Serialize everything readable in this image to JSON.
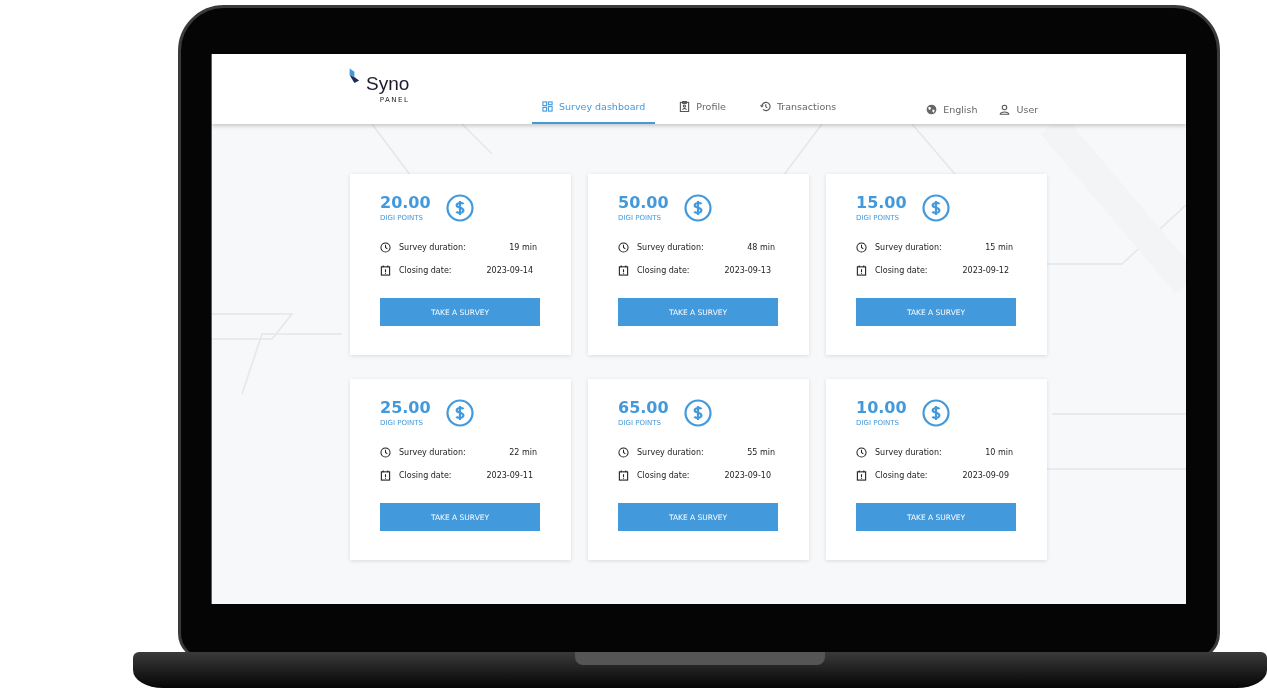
{
  "brand": {
    "name": "Syno",
    "tagline": "PANEL"
  },
  "nav": [
    {
      "label": "Survey dashboard",
      "selected": true
    },
    {
      "label": "Profile",
      "selected": false
    },
    {
      "label": "Transactions",
      "selected": false
    }
  ],
  "actions": [
    {
      "label": "English"
    },
    {
      "label": "User"
    }
  ],
  "surveys": [
    {
      "points": "20.00",
      "unit": "DIGI POINTS",
      "duration_label": "Survey duration:",
      "duration": "19 min",
      "closing_label": "Closing date:",
      "closing_date": "2023-09-14",
      "button": "TAKE A SURVEY"
    },
    {
      "points": "50.00",
      "unit": "DIGI POINTS",
      "duration_label": "Survey duration:",
      "duration": "48 min",
      "closing_label": "Closing date:",
      "closing_date": "2023-09-13",
      "button": "TAKE A SURVEY"
    },
    {
      "points": "15.00",
      "unit": "DIGI POINTS",
      "duration_label": "Survey duration:",
      "duration": "15 min",
      "closing_label": "Closing date:",
      "closing_date": "2023-09-12",
      "button": "TAKE A SURVEY"
    },
    {
      "points": "25.00",
      "unit": "DIGI POINTS",
      "duration_label": "Survey duration:",
      "duration": "22 min",
      "closing_label": "Closing date:",
      "closing_date": "2023-09-11",
      "button": "TAKE A SURVEY"
    },
    {
      "points": "65.00",
      "unit": "DIGI POINTS",
      "duration_label": "Survey duration:",
      "duration": "55 min",
      "closing_label": "Closing date:",
      "closing_date": "2023-09-10",
      "button": "TAKE A SURVEY"
    },
    {
      "points": "10.00",
      "unit": "DIGI POINTS",
      "duration_label": "Survey duration:",
      "duration": "10 min",
      "closing_label": "Closing date:",
      "closing_date": "2023-09-09",
      "button": "TAKE A SURVEY"
    }
  ]
}
